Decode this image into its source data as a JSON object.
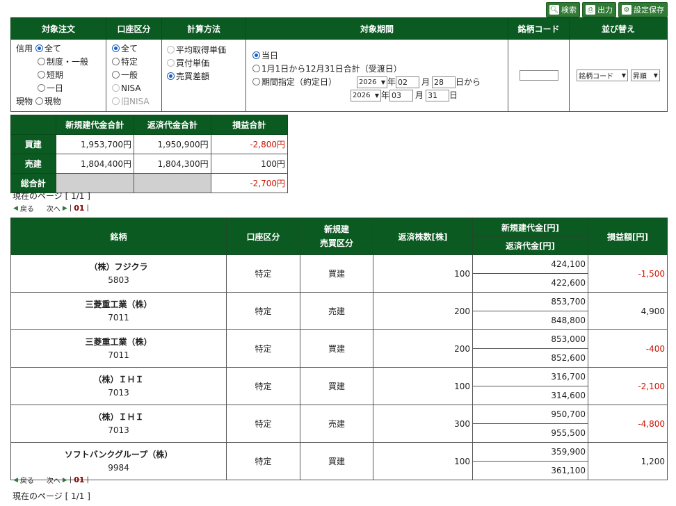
{
  "toolbar": {
    "search_label": "検索",
    "output_label": "出力",
    "save_label": "設定保存"
  },
  "filter": {
    "headers": {
      "order": "対象注文",
      "account": "口座区分",
      "calc": "計算方法",
      "period": "対象期間",
      "code": "銘柄コード",
      "sort": "並び替え"
    },
    "order": {
      "credit_prefix": "信用",
      "cash_prefix": "現物",
      "opt_all": "全て",
      "opt_system": "制度・一般",
      "opt_short": "短期",
      "opt_oneday": "一日",
      "opt_cash": "現物"
    },
    "account": {
      "opt_all": "全て",
      "opt_tokutei": "特定",
      "opt_ippan": "一般",
      "opt_nisa": "NISA",
      "opt_old_nisa": "旧NISA"
    },
    "calc": {
      "opt_avg": "平均取得単価",
      "opt_buy": "買付単価",
      "opt_diff": "売買差額"
    },
    "period": {
      "opt_today": "当日",
      "opt_year": "1月1日から12月31日合計（受渡日）",
      "opt_range": "期間指定（約定日）",
      "from_year": "2026",
      "from_month": "02",
      "from_day": "28",
      "to_year": "2026",
      "to_month": "03",
      "to_day": "31",
      "year_unit": "年",
      "month_unit": "月",
      "day_from_unit": "日から",
      "day_unit": "日"
    },
    "code_value": "",
    "sort": {
      "field": "銘柄コード",
      "order": "昇順"
    }
  },
  "summary": {
    "headers": {
      "new_total": "新規建代金合計",
      "settle_total": "返済代金合計",
      "pl_total": "損益合計"
    },
    "rows": [
      {
        "label": "買建",
        "new": "1,953,700円",
        "settle": "1,950,900円",
        "pl": "-2,800円"
      },
      {
        "label": "売建",
        "new": "1,804,400円",
        "settle": "1,804,300円",
        "pl": "100円"
      }
    ],
    "grand": {
      "label": "総合計",
      "pl": "-2,700円"
    }
  },
  "pagination": {
    "info": "現在のページ [ 1/1 ]",
    "prev": "戻る",
    "next": "次へ",
    "page": "01"
  },
  "results": {
    "headers": {
      "name": "銘柄",
      "account": "口座区分",
      "side_1": "新規建",
      "side_2": "売買区分",
      "qty": "返済株数[株]",
      "new_amount": "新規建代金[円]",
      "settle_amount": "返済代金[円]",
      "pl": "損益額[円]"
    },
    "rows": [
      {
        "name": "（株）フジクラ",
        "code": "5803",
        "account": "特定",
        "side": "買建",
        "qty": "100",
        "new": "424,100",
        "settle": "422,600",
        "pl": "-1,500"
      },
      {
        "name": "三菱重工業（株）",
        "code": "7011",
        "account": "特定",
        "side": "売建",
        "qty": "200",
        "new": "853,700",
        "settle": "848,800",
        "pl": "4,900"
      },
      {
        "name": "三菱重工業（株）",
        "code": "7011",
        "account": "特定",
        "side": "買建",
        "qty": "200",
        "new": "853,000",
        "settle": "852,600",
        "pl": "-400"
      },
      {
        "name": "（株）ＩＨＩ",
        "code": "7013",
        "account": "特定",
        "side": "買建",
        "qty": "100",
        "new": "316,700",
        "settle": "314,600",
        "pl": "-2,100"
      },
      {
        "name": "（株）ＩＨＩ",
        "code": "7013",
        "account": "特定",
        "side": "売建",
        "qty": "300",
        "new": "950,700",
        "settle": "955,500",
        "pl": "-4,800"
      },
      {
        "name": "ソフトバンクグループ（株）",
        "code": "9984",
        "account": "特定",
        "side": "買建",
        "qty": "100",
        "new": "359,900",
        "settle": "361,100",
        "pl": "1,200"
      }
    ]
  },
  "colors": {
    "header_green": "#0b5a21",
    "button_green": "#2f7a34",
    "negative_red": "#cc1100"
  }
}
